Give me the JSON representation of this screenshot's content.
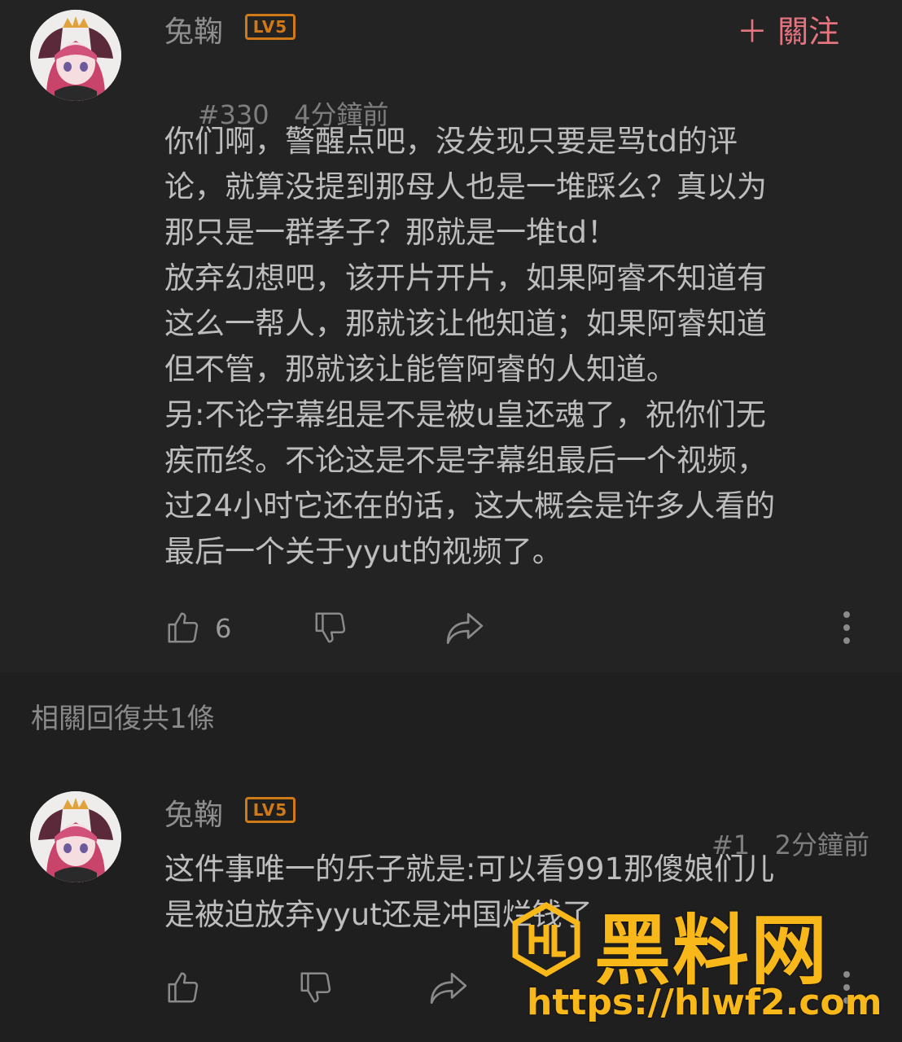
{
  "main_comment": {
    "username": "兔鞠",
    "level": "LV5",
    "follow_label": "＋ 關注",
    "floor": "#330",
    "time": "4分鐘前",
    "body": "你们啊，警醒点吧，没发现只要是骂td的评\n论，就算没提到那母人也是一堆踩么？真以为\n那只是一群孝子？那就是一堆td！\n放弃幻想吧，该开片开片，如果阿睿不知道有\n这么一帮人，那就该让他知道；如果阿睿知道\n但不管，那就该让能管阿睿的人知道。\n另:不论字幕组是不是被u皇还魂了，祝你们无\n疾而终。不论这是不是字幕组最后一个视频，\n过24小时它还在的话，这大概会是许多人看的\n最后一个关于yyut的视频了。",
    "like_count": "6",
    "icons": {
      "like": "thumbs-up-icon",
      "dislike": "thumbs-down-icon",
      "share": "share-icon",
      "more": "more-vertical-icon"
    }
  },
  "replies": {
    "header": "相關回復共1條",
    "items": [
      {
        "username": "兔鞠",
        "level": "LV5",
        "floor": "#1",
        "time": "2分鐘前",
        "body": "这件事唯一的乐子就是:可以看991那傻娘们儿\n是被迫放弃yyut还是冲国烂钱了"
      }
    ]
  },
  "watermark": {
    "title": "黑料网",
    "url": "https://hlwf2.com",
    "logo_text": "HL"
  },
  "colors": {
    "background": "#232323",
    "level_badge": "#d07a17",
    "follow": "#e4747f",
    "watermark": "#f8b81a"
  }
}
